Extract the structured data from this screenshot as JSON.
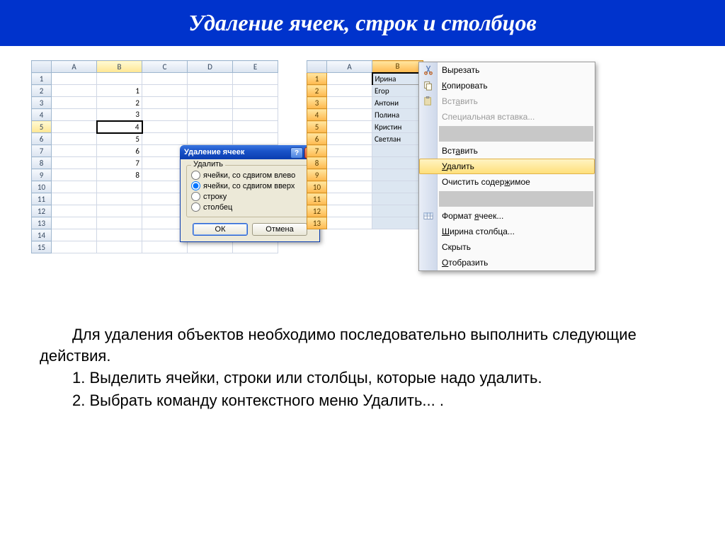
{
  "title": "Удаление ячеек, строк и столбцов",
  "grid1": {
    "cols": [
      "A",
      "B",
      "C",
      "D",
      "E"
    ],
    "rows": [
      "1",
      "2",
      "3",
      "4",
      "5",
      "6",
      "7",
      "8",
      "9",
      "10",
      "11",
      "12",
      "13",
      "14",
      "15"
    ],
    "values": {
      "B2": "1",
      "B3": "2",
      "B4": "3",
      "B5": "4",
      "B6": "5",
      "B7": "6",
      "B8": "7",
      "B9": "8"
    }
  },
  "dialog": {
    "title": "Удаление ячеек",
    "group": "Удалить",
    "options": [
      "ячейки, со сдвигом влево",
      "ячейки, со сдвигом вверх",
      "строку",
      "столбец"
    ],
    "ok": "ОК",
    "cancel": "Отмена"
  },
  "grid2": {
    "cols": [
      "A",
      "B"
    ],
    "rows": [
      "1",
      "2",
      "3",
      "4",
      "5",
      "6",
      "7",
      "8",
      "9",
      "10",
      "11",
      "12",
      "13"
    ],
    "values": {
      "B1": "Ирина",
      "B2": "Егор",
      "B3": "Антони",
      "B4": "Полина",
      "B5": "Кристин",
      "B6": "Светлан"
    }
  },
  "menu": {
    "cut": "Вырезать",
    "copy": "Копировать",
    "paste": "Вставить",
    "pastespecial": "Специальная вставка...",
    "insert": "Вставить",
    "delete": "Удалить",
    "clear": "Очистить содержимое",
    "format": "Формат ячеек...",
    "colwidth": "Ширина столбца...",
    "hide": "Скрыть",
    "show": "Отобразить"
  },
  "body": {
    "p1": "Для удаления объектов необходимо последовательно выполнить следующие действия.",
    "p2": "1. Выделить ячейки, строки или столбцы, которые надо удалить.",
    "p3": "2. Выбрать команду контекстного меню Удалить... ."
  }
}
